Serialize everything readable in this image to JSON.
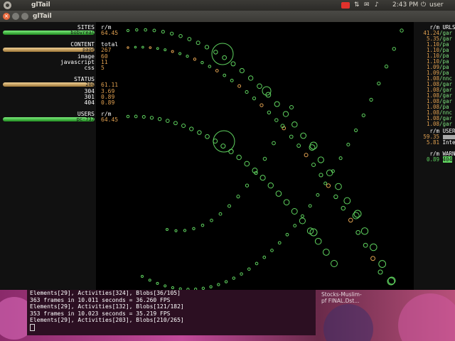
{
  "top_panel": {
    "app_name": "glTail",
    "clock": "2:43 PM",
    "user": "user"
  },
  "window": {
    "title": "glTail"
  },
  "left": {
    "sites": {
      "title": "SITES",
      "unit": "r/m",
      "bar_label": "bobvreal",
      "value": "64.45"
    },
    "content": {
      "title": "CONTENT",
      "unit": "total",
      "rows": [
        {
          "label": "page",
          "value": "267",
          "bar": true
        },
        {
          "label": "image",
          "value": "60"
        },
        {
          "label": "javascript",
          "value": "11"
        },
        {
          "label": "css",
          "value": "5"
        }
      ]
    },
    "status": {
      "title": "STATUS",
      "unit": "r/m",
      "rows": [
        {
          "label": "200",
          "value": "61.11",
          "bar": true
        },
        {
          "label": "304",
          "value": "3.69"
        },
        {
          "label": "301",
          "value": "0.89"
        },
        {
          "label": "404",
          "value": "0.89"
        }
      ]
    },
    "users": {
      "title": "USERS",
      "unit": "r/m",
      "bar_label": "pc-737",
      "value": "64.45"
    }
  },
  "right": {
    "urls": {
      "unit": "r/m",
      "title": "URLS",
      "rows": [
        {
          "value": "41.24",
          "text": "/gar"
        },
        {
          "value": "5.35",
          "text": "/gar"
        },
        {
          "value": "1.10",
          "text": "/pa"
        },
        {
          "value": "1.10",
          "text": "/pa"
        },
        {
          "value": "1.10",
          "text": "/pa"
        },
        {
          "value": "1.10",
          "text": "/pa"
        },
        {
          "value": "1.09",
          "text": "/pa"
        },
        {
          "value": "1.09",
          "text": "/pa"
        },
        {
          "value": "1.08",
          "text": "/nnc"
        },
        {
          "value": "1.08",
          "text": "/gar"
        },
        {
          "value": "1.08",
          "text": "/gar"
        },
        {
          "value": "1.08",
          "text": "/gar"
        },
        {
          "value": "1.08",
          "text": "/gar"
        },
        {
          "value": "1.08",
          "text": "/pa"
        },
        {
          "value": "1.08",
          "text": "/nnc"
        },
        {
          "value": "1.08",
          "text": "/gar"
        },
        {
          "value": "1.08",
          "text": "/gar"
        }
      ]
    },
    "users": {
      "unit": "r/m",
      "title": "USER",
      "rows": [
        {
          "value": "59.35",
          "text": ""
        },
        {
          "value": "5.81",
          "text": "Inte"
        }
      ]
    },
    "warnings": {
      "unit": "r/m",
      "title": "WARN",
      "rows": [
        {
          "value": "0.89",
          "text": "404"
        }
      ]
    }
  },
  "terminal": {
    "lines": [
      "Elements[29], Activities[324], Blobs[36/105]",
      "363 frames in 10.011 seconds = 36.260 FPS",
      "Elements[29], Activities[132], Blobs[121/182]",
      "353 frames in 10.023 seconds = 35.219 FPS",
      "Elements[29], Activities[203], Blobs[210/265]"
    ]
  },
  "desktop": {
    "label_1": "Stocks-Muslim-",
    "label_2": "pf FINAL.Dst..."
  },
  "colors": {
    "accent_green": "#5fd35f",
    "value_orange": "#e0a050",
    "panel_dark": "#111111"
  }
}
